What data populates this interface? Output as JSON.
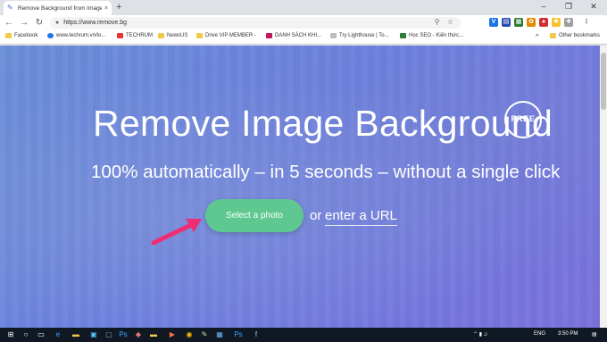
{
  "browser": {
    "tab_title": "Remove Background from Image",
    "tab_close": "×",
    "new_tab": "+",
    "window_controls": {
      "minimize": "–",
      "maximize": "❐",
      "close": "✕"
    },
    "back": "←",
    "forward": "→",
    "reload": "↻",
    "url": "https://www.remove.bg",
    "lock": "🔒"
  },
  "bookmarks": [
    {
      "label": "Facebook"
    },
    {
      "label": "www.techrum.vn/lo..."
    },
    {
      "label": "TECHRUM"
    },
    {
      "label": "NewsUS"
    },
    {
      "label": "Drive VIP MEMBER -"
    },
    {
      "label": "DANH SÁCH KHI..."
    },
    {
      "label": "Try Lighthouse | To..."
    },
    {
      "label": "Học SEO - Kiến thức..."
    }
  ],
  "bookmarks_more": "»",
  "other_bookmarks": "Other bookmarks",
  "hero": {
    "title": "Remove Image Background",
    "badge": "FREE",
    "subtitle": "100% automatically – in 5 seconds – without a single click",
    "select_button": "Select a photo",
    "or_text": "or",
    "url_link": "enter a URL"
  },
  "taskbar": {
    "language": "ENG",
    "time": "3:50 PM"
  },
  "colors": {
    "button_green": "#5ec890",
    "arrow_pink": "#ee2d73",
    "page_blue": "#6c7ee0"
  }
}
